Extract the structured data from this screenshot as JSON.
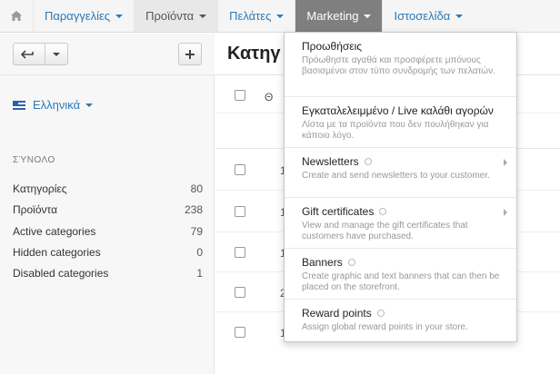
{
  "nav": {
    "items": [
      {
        "label": "Παραγγελίες"
      },
      {
        "label": "Προϊόντα"
      },
      {
        "label": "Πελάτες"
      },
      {
        "label": "Marketing"
      },
      {
        "label": "Ιστοσελίδα"
      }
    ]
  },
  "sidebar": {
    "language": "Ελληνικά",
    "summary_title": "ΣΎΝΟΛΟ",
    "stats": [
      {
        "label": "Κατηγορίες",
        "value": "80"
      },
      {
        "label": "Προϊόντα",
        "value": "238"
      },
      {
        "label": "Active categories",
        "value": "79"
      },
      {
        "label": "Hidden categories",
        "value": "0"
      },
      {
        "label": "Disabled categories",
        "value": "1"
      }
    ]
  },
  "main": {
    "title": "Κατηγ",
    "header_col": "Θ",
    "row_fragments": [
      "1",
      "1",
      "1",
      "2",
      "1"
    ]
  },
  "dropdown": {
    "items": [
      {
        "title": "Προωθήσεις",
        "desc": "Πρόωθηστε αγαθά και προσφέρετε μπόνους βασισμένοι στον τύπο συνδρομής των πελατών."
      },
      {
        "title": "Εγκαταλελειμμένο / Live καλάθι αγορών",
        "desc": "Λίστα με τα προϊόντα που δεν πουλήθηκαν για κάποιο λόγο."
      },
      {
        "title": "Newsletters",
        "desc": "Create and send newsletters to your customer."
      },
      {
        "title": "Gift certificates",
        "desc": "View and manage the gift certificates that customers have purchased."
      },
      {
        "title": "Banners",
        "desc": "Create graphic and text banners that can then be placed on the storefront."
      },
      {
        "title": "Reward points",
        "desc": "Assign global reward points in your store."
      }
    ]
  },
  "colors": {
    "link": "#2a7ab8",
    "open_menu": "#7f7f7f"
  }
}
